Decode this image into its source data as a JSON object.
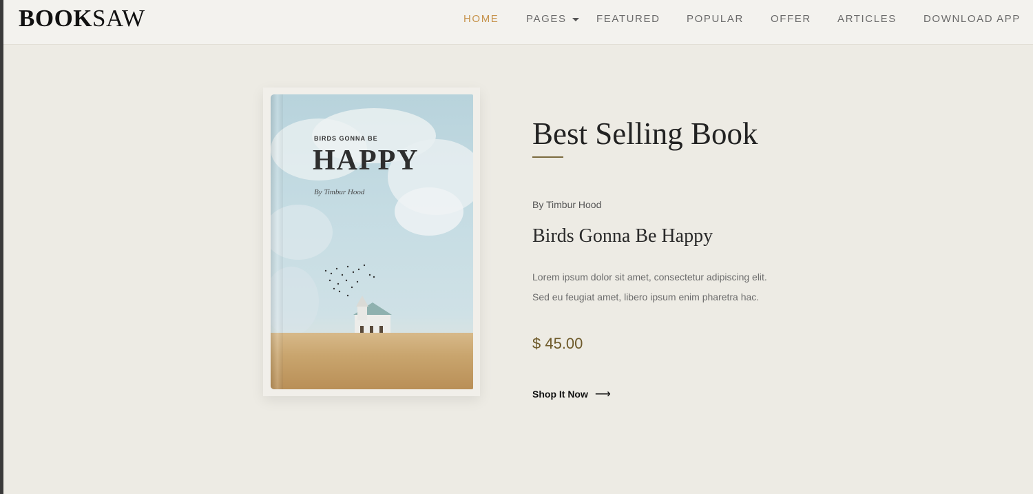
{
  "brand": {
    "logo_bold": "BOOK",
    "logo_thin": "SAW"
  },
  "nav": {
    "items": [
      {
        "label": "HOME",
        "active": true
      },
      {
        "label": "PAGES",
        "dropdown": true
      },
      {
        "label": "FEATURED"
      },
      {
        "label": "POPULAR"
      },
      {
        "label": "OFFER"
      },
      {
        "label": "ARTICLES"
      },
      {
        "label": "DOWNLOAD APP"
      }
    ]
  },
  "cover": {
    "small_title": "BIRDS GONNA BE",
    "big_title": "HAPPY",
    "author": "By Timbur Hood"
  },
  "hero": {
    "section_title": "Best Selling Book",
    "author": "By Timbur Hood",
    "book_title": "Birds Gonna Be Happy",
    "description_line1": "Lorem ipsum dolor sit amet, consectetur adipiscing elit.",
    "description_line2": "Sed eu feugiat amet, libero ipsum enim pharetra hac.",
    "price": "$ 45.00",
    "cta_label": "Shop It Now",
    "cta_icon": "arrow-right-icon"
  },
  "colors": {
    "background": "#EDEBE4",
    "header": "#F3F2EE",
    "accent": "#C6934B",
    "price": "#6E5A2A"
  }
}
